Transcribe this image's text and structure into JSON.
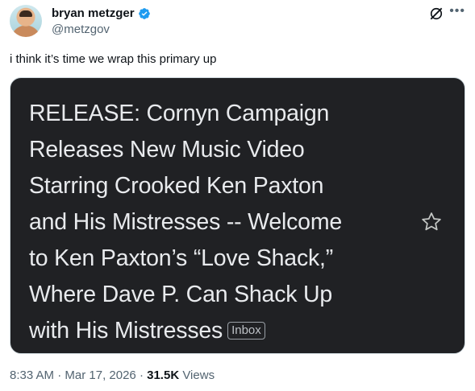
{
  "author": {
    "display_name": "bryan metzger",
    "handle": "@metzgov"
  },
  "tweet": {
    "text": "i think it’s time we wrap this primary up"
  },
  "email_card": {
    "subject_lines": [
      "RELEASE: Cornyn Campaign",
      "Releases New Music Video",
      "Starring Crooked Ken Paxton",
      "and His Mistresses -- Welcome",
      "to Ken Paxton’s “Love Shack,”",
      "Where Dave P. Can Shack Up",
      "with His Mistresses"
    ],
    "label": "Inbox",
    "icons": {
      "star": "star-icon"
    }
  },
  "meta": {
    "time": "8:33 AM",
    "separator": "·",
    "date": "Mar 17, 2026",
    "views_count": "31.5K",
    "views_label": "Views"
  },
  "icons": {
    "verified": "verified-badge-icon",
    "grok": "grok-icon",
    "more": "more-icon"
  },
  "colors": {
    "verified_blue": "#1d9bf0",
    "card_bg": "#202124",
    "card_text": "#e8eaed",
    "secondary_text": "#536471"
  }
}
